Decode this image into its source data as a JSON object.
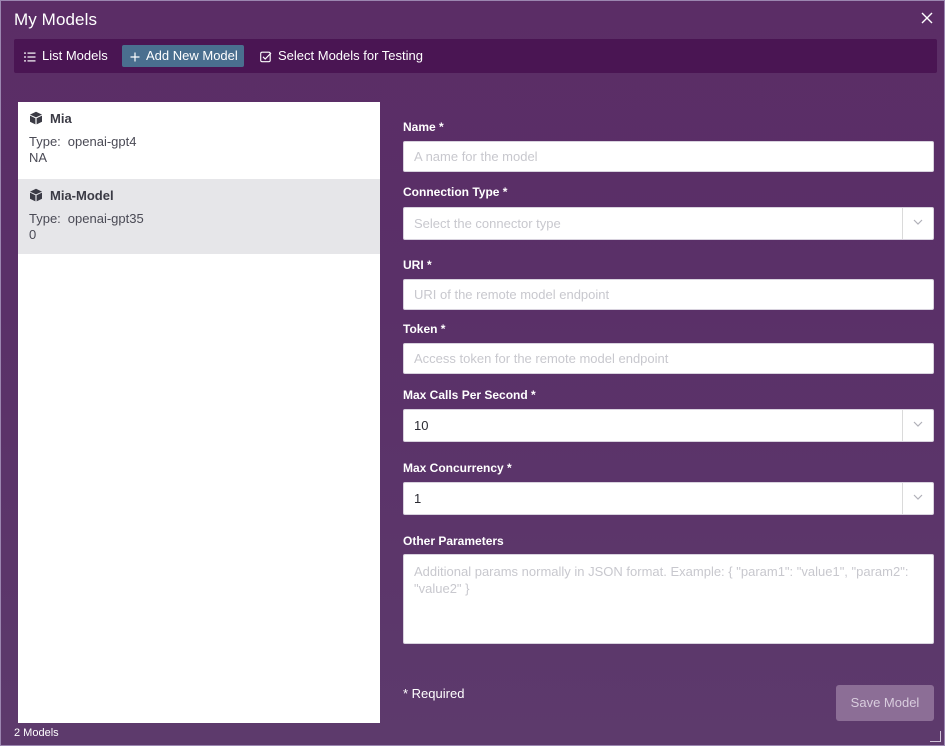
{
  "window": {
    "title": "My Models"
  },
  "toolbar": {
    "list_label": "List Models",
    "add_label": "Add New Model",
    "select_label": "Select Models for Testing"
  },
  "models": [
    {
      "name": "Mia",
      "type_label": "Type:",
      "type": "openai-gpt4",
      "extra": "NA"
    },
    {
      "name": "Mia-Model",
      "type_label": "Type:",
      "type": "openai-gpt35",
      "extra": "0"
    }
  ],
  "form": {
    "name": {
      "label": "Name *",
      "placeholder": "A name for the model"
    },
    "connection_type": {
      "label": "Connection Type *",
      "placeholder": "Select the connector type"
    },
    "uri": {
      "label": "URI *",
      "placeholder": "URI of the remote model endpoint"
    },
    "token": {
      "label": "Token *",
      "placeholder": "Access token for the remote model endpoint"
    },
    "max_calls": {
      "label": "Max Calls Per Second *",
      "value": "10"
    },
    "max_concurrency": {
      "label": "Max Concurrency *",
      "value": "1"
    },
    "other_params": {
      "label": "Other Parameters",
      "placeholder": "Additional params normally in JSON format. Example: { \"param1\": \"value1\", \"param2\": \"value2\" }"
    },
    "required_note": "* Required",
    "save_label": "Save Model"
  },
  "status": {
    "count": "2 Models"
  },
  "colors": {
    "background": "#5b2d66",
    "toolbar": "#4a1553",
    "active_button": "#4a6f8f",
    "save_button": "#8c6e96",
    "selected_row": "#e6e6e9"
  },
  "icons": [
    "list-icon",
    "plus-icon",
    "checkbox-icon",
    "close-icon",
    "cube-icon",
    "chevron-down-icon"
  ]
}
